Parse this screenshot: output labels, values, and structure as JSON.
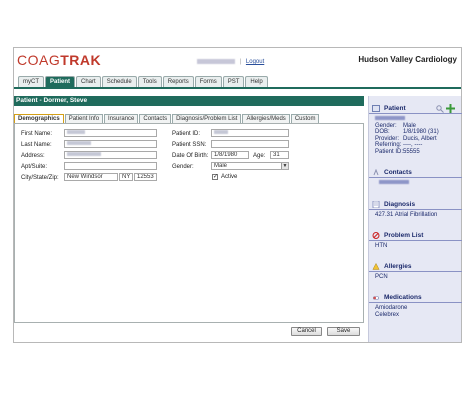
{
  "brand": {
    "logo_part1": "COAG",
    "logo_part2": "TRAK",
    "practice": "Hudson Valley Cardiology"
  },
  "userbar": {
    "logout": "Logout",
    "separator": "|"
  },
  "nav": {
    "tabs": [
      "myCT",
      "Patient",
      "Chart",
      "Schedule",
      "Tools",
      "Reports",
      "Forms",
      "PST",
      "Help"
    ],
    "active": "Patient"
  },
  "section": {
    "title": "Patient - Dormer, Steve"
  },
  "subtabs": {
    "items": [
      "Demographics",
      "Patient Info",
      "Insurance",
      "Contacts",
      "Diagnosis/Problem List",
      "Allergies/Meds",
      "Custom"
    ],
    "active": "Demographics"
  },
  "form": {
    "first_name_label": "First Name:",
    "last_name_label": "Last Name:",
    "address_label": "Address:",
    "apt_label": "Apt/Suite:",
    "csz_label": "City/State/Zip:",
    "city": "New Windsor",
    "state": "NY",
    "zip": "12553",
    "patient_id_label": "Patient ID:",
    "ssn_label": "Patient SSN:",
    "dob_label": "Date Of Birth:",
    "dob": "1/8/1980",
    "age_label": "Age:",
    "age": "31",
    "gender_label": "Gender:",
    "gender": "Male",
    "active_label": "Active"
  },
  "buttons": {
    "cancel": "Cancel",
    "save": "Save"
  },
  "sidebar": {
    "patient": {
      "title": "Patient",
      "gender_label": "Gender:",
      "gender": "Male",
      "dob_label": "DOB:",
      "dob": "1/8/1980 (31)",
      "provider_label": "Provider:",
      "provider": "Ducis, Albert",
      "referring_label": "Referring:",
      "referring": "----, ----",
      "patient_id_label": "Patient ID:",
      "patient_id": "55555"
    },
    "contacts": {
      "title": "Contacts"
    },
    "diagnosis": {
      "title": "Diagnosis",
      "item": "427.31 Atrial Fibrillation"
    },
    "problem_list": {
      "title": "Problem List",
      "item": "HTN"
    },
    "allergies": {
      "title": "Allergies",
      "item": "PCN"
    },
    "medications": {
      "title": "Medications",
      "items": [
        "Amiodarone",
        "Celebrex"
      ]
    }
  },
  "colors": {
    "accent": "#1f6b5c",
    "brand_red": "#c0392b",
    "sidebar_bg": "#e6e8f4",
    "sidebar_text": "#1c2a6b"
  }
}
